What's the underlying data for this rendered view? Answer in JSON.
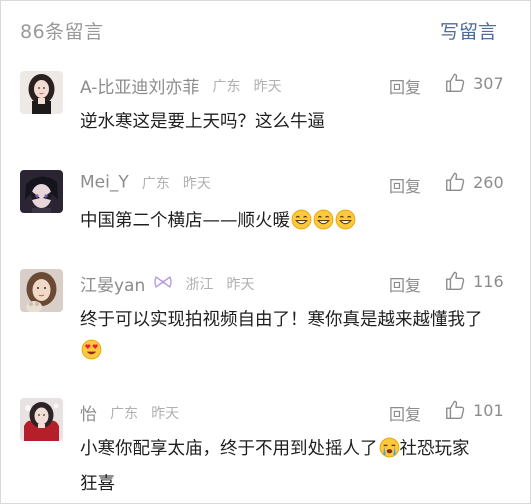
{
  "header": {
    "comment_count": "86条留言",
    "write_label": "写留言"
  },
  "comments": [
    {
      "name": "A-比亚迪刘亦菲",
      "region": "广东",
      "time": "昨天",
      "reply": "回复",
      "likes": "307",
      "text_parts": [
        "逆水寒这是要上天吗？这么牛逼"
      ],
      "emojis": []
    },
    {
      "name": "Mei_Y",
      "region": "广东",
      "time": "昨天",
      "reply": "回复",
      "likes": "260",
      "text_parts": [
        "中国第二个横店——顺火暖"
      ],
      "emojis": [
        "grin",
        "grin",
        "grin"
      ]
    },
    {
      "name": "江晏yan",
      "region": "浙江",
      "time": "昨天",
      "reply": "回复",
      "likes": "116",
      "text_parts": [
        "终于可以实现拍视频自由了！寒你真是越来越懂我了"
      ],
      "emojis": [
        "heart-eyes"
      ],
      "badge": "bow-icon"
    },
    {
      "name": "怡",
      "region": "广东",
      "time": "昨天",
      "reply": "回复",
      "likes": "101",
      "text_parts": [
        "小寒你配享太庙，终于不用到处摇人了",
        "社恐玩家狂喜"
      ],
      "emojis": [
        "crying"
      ]
    }
  ],
  "colors": {
    "link": "#4f6d96",
    "muted": "#8c8c8c",
    "light": "#b0b0b0",
    "text": "#1f1f1f",
    "emoji": "#ffc83d"
  }
}
